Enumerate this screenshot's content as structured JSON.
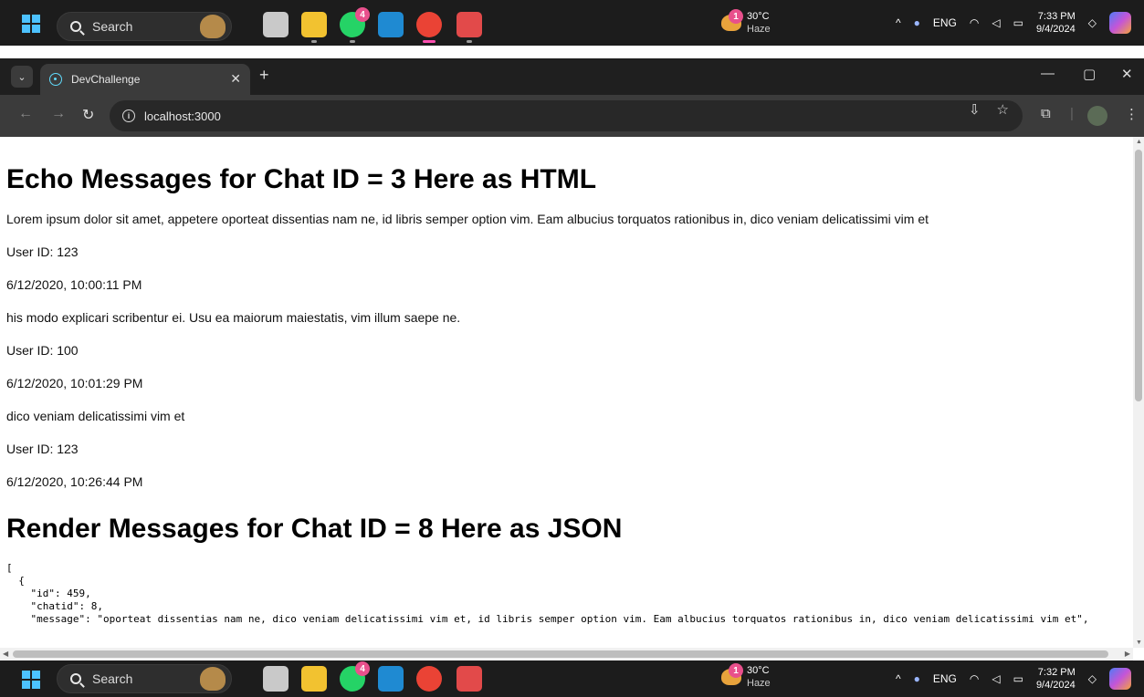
{
  "taskbar_top": {
    "search_label": "Search",
    "whatsapp_badge": "4",
    "weather": {
      "badge": "1",
      "temp": "30°C",
      "condition": "Haze"
    },
    "language": "ENG",
    "time": "7:33 PM",
    "date": "9/4/2024"
  },
  "taskbar_bottom": {
    "search_label": "Search",
    "whatsapp_badge": "4",
    "weather": {
      "badge": "1",
      "temp": "30°C",
      "condition": "Haze"
    },
    "language": "ENG",
    "time": "7:32 PM",
    "date": "9/4/2024"
  },
  "browser": {
    "tab_title": "DevChallenge",
    "url": "localhost:3000"
  },
  "page": {
    "heading_html": "Echo Messages for Chat ID = 3 Here as HTML",
    "messages": [
      {
        "text": "Lorem ipsum dolor sit amet, appetere oporteat dissentias nam ne, id libris semper option vim. Eam albucius torquatos rationibus in, dico veniam delicatissimi vim et",
        "user": "User ID: 123",
        "time": "6/12/2020, 10:00:11 PM"
      },
      {
        "text": "his modo explicari scribentur ei. Usu ea maiorum maiestatis, vim illum saepe ne.",
        "user": "User ID: 100",
        "time": "6/12/2020, 10:01:29 PM"
      },
      {
        "text": "dico veniam delicatissimi vim et",
        "user": "User ID: 123",
        "time": "6/12/2020, 10:26:44 PM"
      }
    ],
    "heading_json": "Render Messages for Chat ID = 8 Here as JSON",
    "json_text": "[\n  {\n    \"id\": 459,\n    \"chatid\": 8,\n    \"message\": \"oporteat dissentias nam ne, dico veniam delicatissimi vim et, id libris semper option vim. Eam albucius torquatos rationibus in, dico veniam delicatissimi vim et\","
  },
  "colors": {
    "taskbar_bg": "#1c1c1c",
    "browser_tabstrip": "#1f1f1f",
    "browser_toolbar": "#3b3b3b",
    "accent_blue": "#4cc2ff",
    "badge_pink": "#e8508c"
  }
}
